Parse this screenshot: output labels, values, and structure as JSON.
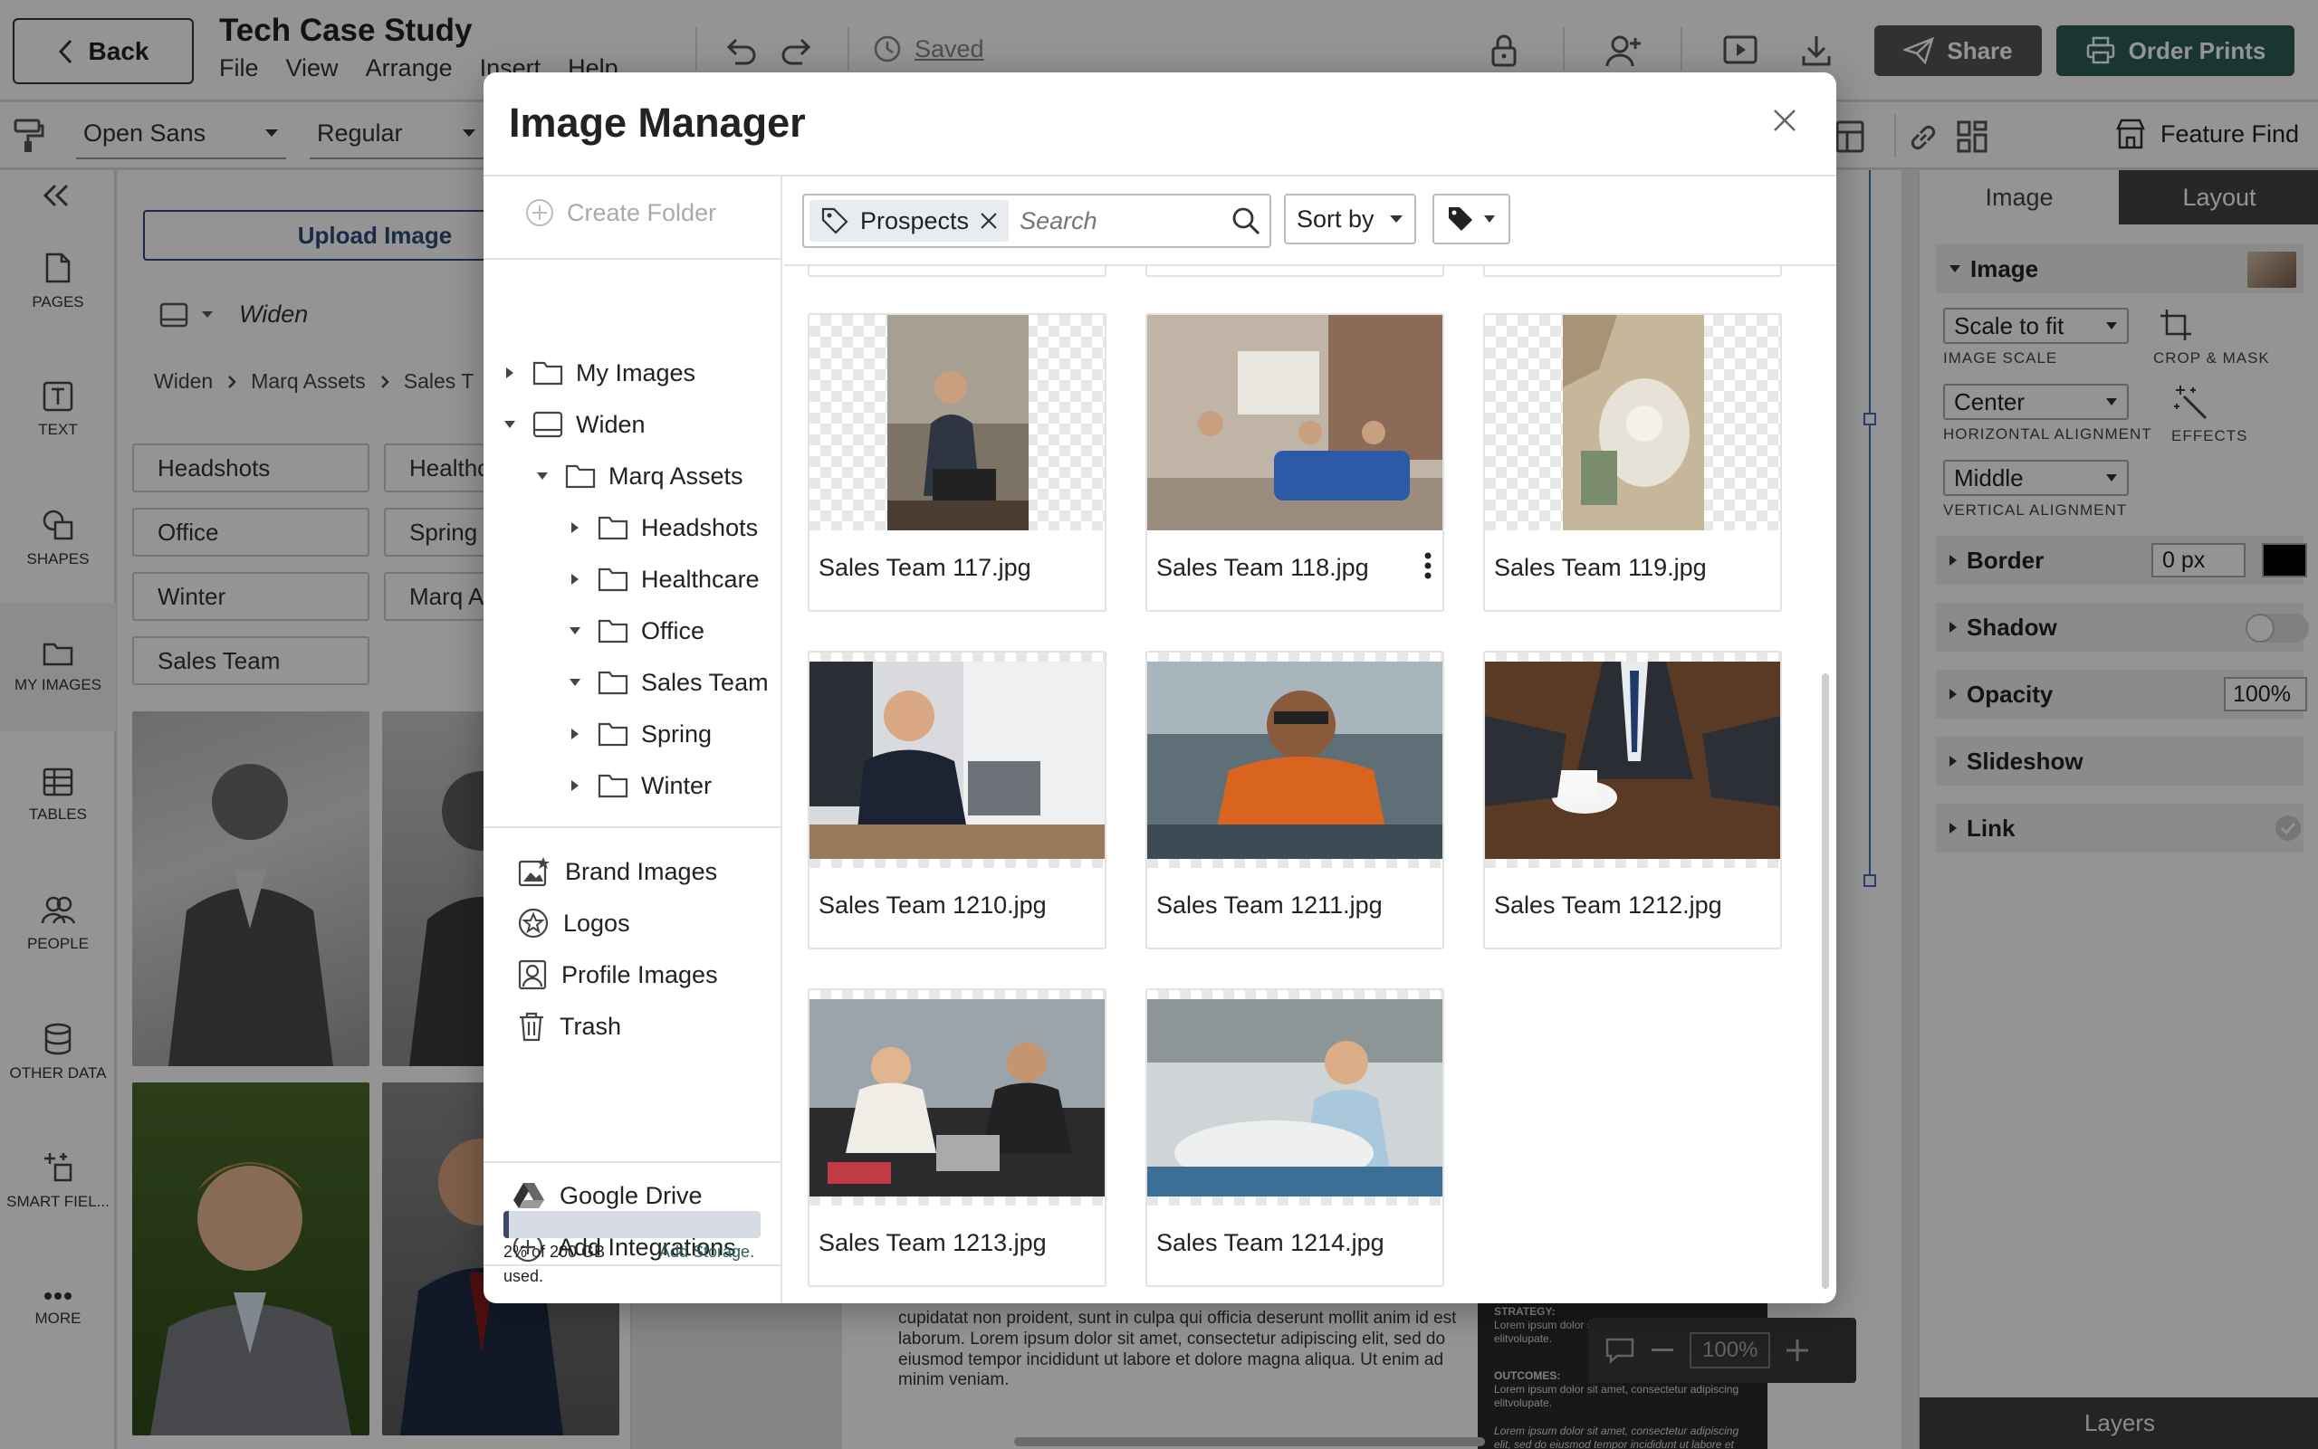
{
  "app": {
    "back_label": "Back",
    "doc_title": "Tech Case Study",
    "menu": [
      "File",
      "View",
      "Arrange",
      "Insert",
      "Help"
    ],
    "saved_label": "Saved",
    "share_label": "Share",
    "order_prints_label": "Order Prints"
  },
  "format_bar": {
    "font": "Open Sans",
    "weight": "Regular",
    "feature_find_label": "Feature Find"
  },
  "sidebar": {
    "items": [
      {
        "label": "PAGES",
        "icon": "page-icon"
      },
      {
        "label": "TEXT",
        "icon": "text-icon"
      },
      {
        "label": "SHAPES",
        "icon": "shapes-icon"
      },
      {
        "label": "MY IMAGES",
        "icon": "folder-icon"
      },
      {
        "label": "TABLES",
        "icon": "table-icon"
      },
      {
        "label": "PEOPLE",
        "icon": "people-icon"
      },
      {
        "label": "OTHER DATA",
        "icon": "database-icon"
      },
      {
        "label": "SMART FIEL...",
        "icon": "smart-fields-icon"
      },
      {
        "label": "MORE",
        "icon": "more-icon"
      }
    ]
  },
  "left_panel": {
    "upload_label": "Upload Image",
    "source_name": "Widen",
    "breadcrumb": [
      "Widen",
      "Marq Assets",
      "Sales T"
    ],
    "folders_col1": [
      "Headshots",
      "Office",
      "Winter",
      "Sales Team"
    ],
    "folders_col2": [
      "Healthc",
      "Spring",
      "Marq A"
    ]
  },
  "right_panel": {
    "tab_image": "Image",
    "tab_layout": "Layout",
    "section_image": "Image",
    "image_scale_value": "Scale to fit",
    "image_scale_caption": "IMAGE SCALE",
    "crop_caption": "CROP & MASK",
    "h_align_value": "Center",
    "h_align_caption": "HORIZONTAL ALIGNMENT",
    "effects_caption": "EFFECTS",
    "v_align_value": "Middle",
    "v_align_caption": "VERTICAL ALIGNMENT",
    "border_label": "Border",
    "border_value": "0 px",
    "border_color": "#000000",
    "shadow_label": "Shadow",
    "opacity_label": "Opacity",
    "opacity_value": "100%",
    "slideshow_label": "Slideshow",
    "link_label": "Link",
    "layers_label": "Layers"
  },
  "canvas": {
    "body_text": "cupidatat non proident, sunt in culpa qui officia deserunt mollit anim id est laborum. Lorem ipsum dolor sit amet, consectetur adipiscing elit, sed do eiusmod tempor incididunt ut labore et dolore magna aliqua. Ut enim ad minim veniam.",
    "strategy_label": "STRATEGY:",
    "strategy_text": "Lorem ipsum dolor sit amet, consectetur adipiscing elitvolupate.",
    "outcomes_label": "OUTCOMES:",
    "outcomes_text": "Lorem ipsum dolor sit amet, consectetur adipiscing elitvolupate.",
    "footer_text": "Lorem ipsum dolor sit amet, consectetur adipiscing elit, sed do eiusmod tempor incididunt ut labore et dolore magna",
    "zoom": "100%"
  },
  "modal": {
    "title": "Image Manager",
    "create_folder_label": "Create Folder",
    "tree": {
      "my_images": "My Images",
      "widen": "Widen",
      "marq_assets": "Marq Assets",
      "children": [
        "Headshots",
        "Healthcare",
        "Office",
        "Sales Team",
        "Spring",
        "Winter"
      ]
    },
    "special": [
      "Brand Images",
      "Logos",
      "Profile Images",
      "Trash"
    ],
    "integrations": [
      "Google Drive",
      "Add Integrations"
    ],
    "storage": {
      "used_label": "2% of 200 GB used.",
      "add_label": "Add Storage.",
      "used_fraction": 0.02
    },
    "filter_tag": "Prospects",
    "search_placeholder": "Search",
    "sort_label": "Sort by",
    "images": [
      "Sales Team 117.jpg",
      "Sales Team 118.jpg",
      "Sales Team 119.jpg",
      "Sales Team 1210.jpg",
      "Sales Team 1211.jpg",
      "Sales Team 1212.jpg",
      "Sales Team 1213.jpg",
      "Sales Team 1214.jpg"
    ]
  }
}
